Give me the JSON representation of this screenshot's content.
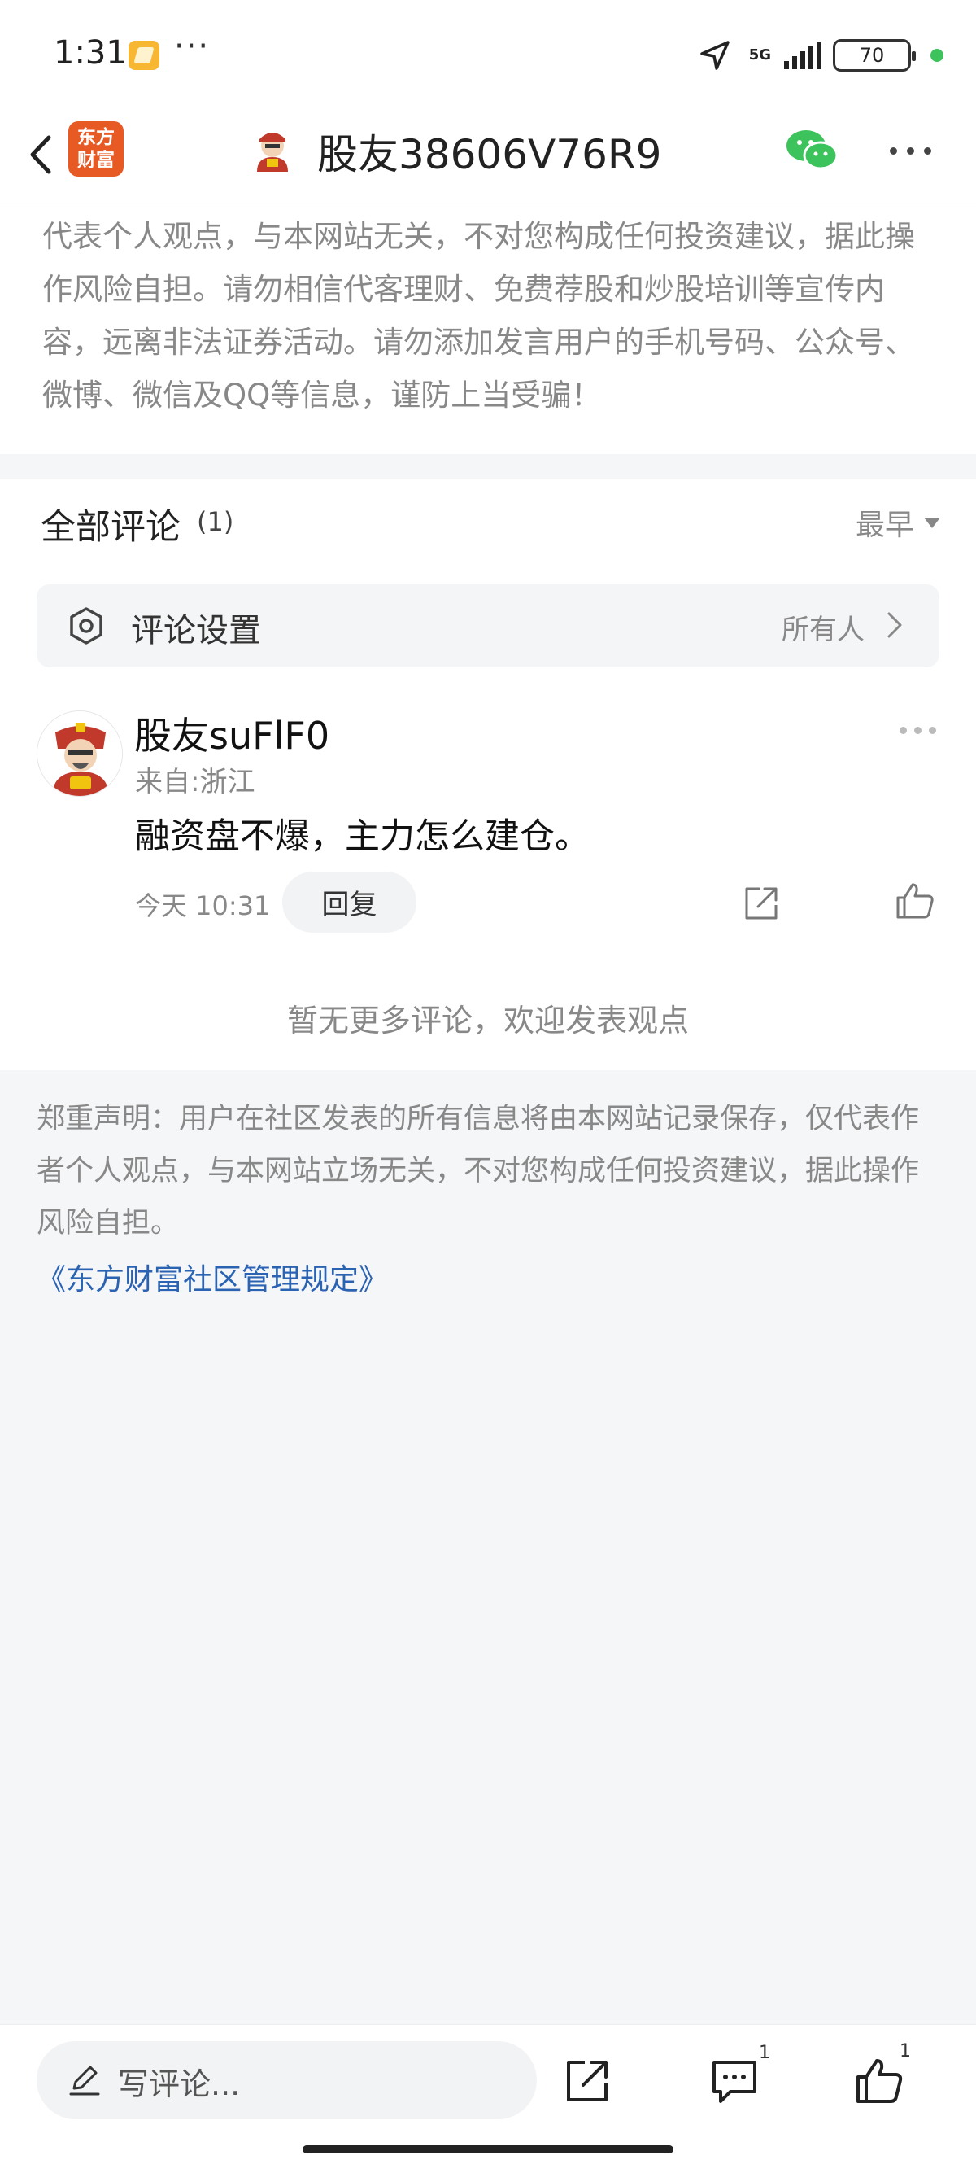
{
  "status_bar": {
    "time": "1:31",
    "dots": "···",
    "network": "5G",
    "battery": "70",
    "icons": [
      "location-arrow-icon",
      "signal-icon",
      "battery-icon"
    ]
  },
  "header": {
    "logo_text": "东方财富",
    "title": "股友38606V76R9",
    "icons": [
      "back-icon",
      "wechat-icon",
      "more-icon"
    ]
  },
  "top_disclaimer": "代表个人观点，与本网站无关，不对您构成任何投资建议，据此操作风险自担。请勿相信代客理财、免费荐股和炒股培训等宣传内容，远离非法证券活动。请勿添加发言用户的手机号码、公众号、微博、微信及QQ等信息，谨防上当受骗！",
  "comments": {
    "title": "全部评论",
    "count": "(1)",
    "sort_label": "最早",
    "settings": {
      "label": "评论设置",
      "value": "所有人"
    },
    "items": [
      {
        "author": "股友suFlF0",
        "location": "来自:浙江",
        "text": "融资盘不爆，主力怎么建仓。",
        "time": "今天 10:31",
        "reply_label": "回复"
      }
    ],
    "no_more": "暂无更多评论，欢迎发表观点"
  },
  "statement": "郑重声明：用户在社区发表的所有信息将由本网站记录保存，仅代表作者个人观点，与本网站立场无关，不对您构成任何投资建议，据此操作风险自担。",
  "rules_link": "《东方财富社区管理规定》",
  "bottom_bar": {
    "input_placeholder": "写评论...",
    "comment_count": "1",
    "like_count": "1"
  },
  "colors": {
    "brand": "#e85a24",
    "link": "#2b63b3",
    "wechat": "#3cc35b",
    "background": "#f5f6f8"
  }
}
